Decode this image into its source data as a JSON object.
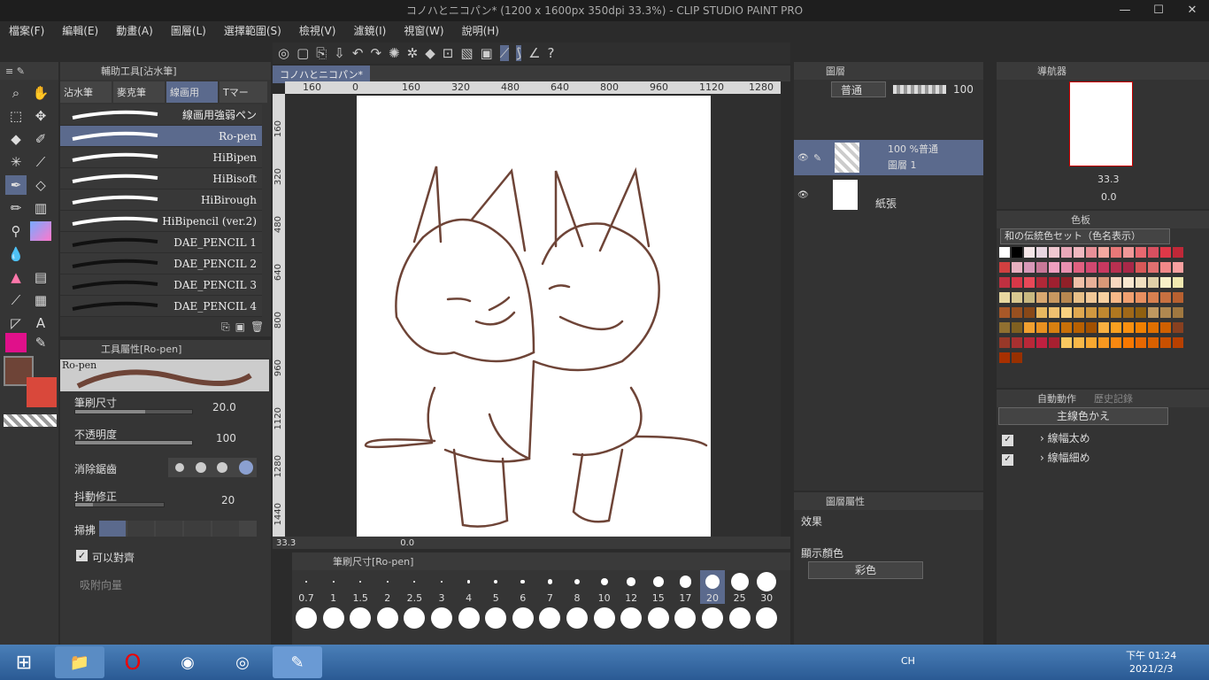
{
  "window": {
    "title": "コノハとニコパン* (1200 x 1600px 350dpi 33.3%) - CLIP STUDIO PAINT PRO",
    "minimize": "—",
    "maximize": "☐",
    "close": "✕"
  },
  "menu": [
    "檔案(F)",
    "編輯(E)",
    "動畫(A)",
    "圖層(L)",
    "選擇範圍(S)",
    "檢視(V)",
    "濾鏡(I)",
    "視窗(W)",
    "說明(H)"
  ],
  "sub_tool": {
    "panel_title": "輔助工具[沾水筆]",
    "tabs": [
      "沾水筆",
      "麥克筆",
      "線画用",
      "Tマー"
    ],
    "brushes": [
      "線画用強弱ペン",
      "Ro-pen",
      "HiBipen",
      "HiBisoft",
      "HiBirough",
      "HiBipencil (ver.2)",
      "DAE_PENCIL 1",
      "DAE_PENCIL 2",
      "DAE_PENCIL 3",
      "DAE_PENCIL 4"
    ],
    "selected_index": 1
  },
  "tool_property": {
    "panel_title": "工具屬性[Ro-pen]",
    "preview_label": "Ro-pen",
    "brush_size_label": "筆刷尺寸",
    "brush_size_value": "20.0",
    "opacity_label": "不透明度",
    "opacity_value": "100",
    "antialias_label": "消除鋸齒",
    "stabilization_label": "抖動修正",
    "stabilization_value": "20",
    "taper_label": "掃拂",
    "snap_label": "可以對齊",
    "snap_dir_label": "吸附向量"
  },
  "canvas": {
    "tab_label": "コノハとニコパン*",
    "zoom": "33.3",
    "rotation": "0.0",
    "ruler_h": [
      "160",
      "0",
      "160",
      "320",
      "480",
      "640",
      "800",
      "960",
      "1120",
      "1280"
    ],
    "ruler_v": [
      "160",
      "320",
      "480",
      "640",
      "800",
      "960",
      "1120",
      "1280",
      "1440"
    ]
  },
  "brush_size_panel": {
    "title": "筆刷尺寸[Ro-pen]",
    "sizes": [
      "0.7",
      "1",
      "1.5",
      "2",
      "2.5",
      "3",
      "4",
      "5",
      "6",
      "7",
      "8",
      "10",
      "12",
      "15",
      "17",
      "20",
      "25",
      "30"
    ],
    "selected": "20"
  },
  "layers": {
    "panel_title": "圖層",
    "blend_mode": "普通",
    "opacity": "100",
    "items": [
      {
        "name": "圖層 1",
        "info": "100 %普通"
      },
      {
        "name": "紙張",
        "info": ""
      }
    ]
  },
  "layer_property": {
    "panel_title": "圖層屬性",
    "effect_label": "效果",
    "display_color_label": "顯示顏色",
    "display_color_value": "彩色"
  },
  "navigator": {
    "panel_title": "導航器",
    "zoom": "33.3",
    "rotation": "0.0"
  },
  "color_set": {
    "panel_title": "色板",
    "set_name": "和の伝統色セット（色名表示）"
  },
  "auto_action": {
    "panel_title": "自動動作",
    "history_title": "歷史記錄",
    "set_name": "主線色かえ",
    "items": [
      "線幅太め",
      "線幅細め"
    ]
  },
  "colors": {
    "main": "#6e4437",
    "sub": "#d9483b",
    "accent": "#5b6a8d",
    "line": "#6e4437"
  },
  "taskbar": {
    "lang": "CH",
    "time": "下午 01:24",
    "date": "2021/2/3"
  }
}
